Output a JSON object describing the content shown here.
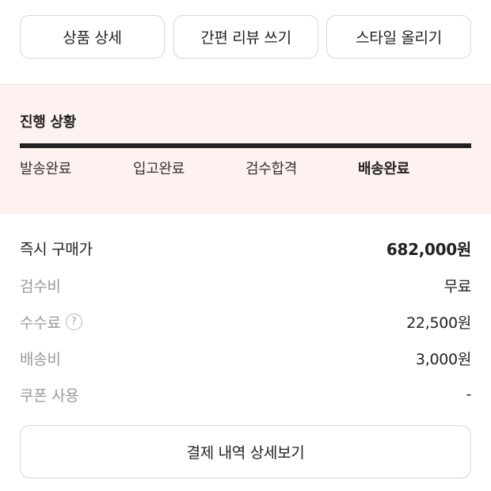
{
  "actions": {
    "product_detail": "상품 상세",
    "quick_review": "간편 리뷰 쓰기",
    "style_upload": "스타일 올리기"
  },
  "progress": {
    "title": "진행 상황",
    "steps": [
      "발송완료",
      "입고완료",
      "검수합격",
      "배송완료"
    ],
    "current_step": 4,
    "fill_fraction": 1.0
  },
  "price": {
    "instant_buy_label": "즉시 구매가",
    "instant_buy_value": "682,000원",
    "inspection_label": "검수비",
    "inspection_value": "무료",
    "fee_label": "수수료",
    "fee_value": "22,500원",
    "shipping_label": "배송비",
    "shipping_value": "3,000원",
    "coupon_label": "쿠폰 사용",
    "coupon_value": "-"
  },
  "detail_button_label": "결제 내역 상세보기",
  "help_icon_glyph": "?",
  "colors": {
    "progress_bg": "#fdf2f0",
    "progress_fill": "#222222",
    "muted_text": "#9a9a9a"
  }
}
